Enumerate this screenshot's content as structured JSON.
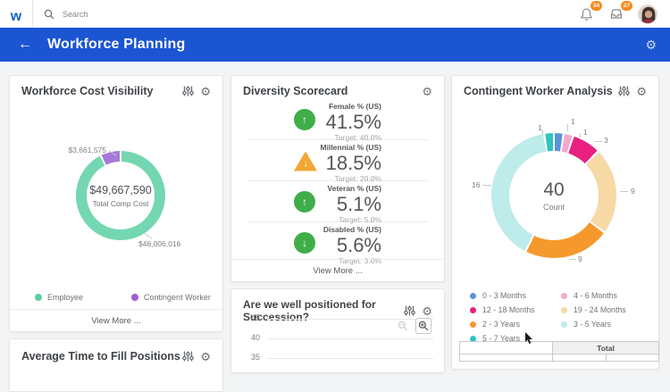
{
  "topbar": {
    "logo_letter": "w",
    "search_placeholder": "Search",
    "notifications_count": "34",
    "inbox_count": "27"
  },
  "header": {
    "back_arrow": "←",
    "title": "Workforce Planning"
  },
  "cards": {
    "workforce_cost": {
      "title": "Workforce Cost Visibility",
      "center_value": "$49,667,590",
      "center_label": "Total Comp Cost",
      "callout_contingent": "$3,661,575",
      "callout_employee": "$46,006,016",
      "legend": [
        {
          "label": "Employee",
          "color": "#5ecf9e"
        },
        {
          "label": "Contingent Worker",
          "color": "#9d5fd3"
        }
      ],
      "view_more": "View More ..."
    },
    "diversity": {
      "title": "Diversity Scorecard",
      "items": [
        {
          "label": "Female % (US)",
          "value": "41.5%",
          "target": "Target: 40.0%",
          "status": "up",
          "arrow": "↑",
          "color": "#3fae49"
        },
        {
          "label": "Millennial % (US)",
          "value": "18.5%",
          "target": "Target: 20.0%",
          "status": "warning",
          "arrow": "↓",
          "color": "#f0a734"
        },
        {
          "label": "Veteran % (US)",
          "value": "5.1%",
          "target": "Target: 5.0%",
          "status": "up",
          "arrow": "↑",
          "color": "#3fae49"
        },
        {
          "label": "Disabled % (US)",
          "value": "5.6%",
          "target": "Target: 3.0%",
          "status": "down",
          "arrow": "↓",
          "color": "#3fae49"
        }
      ],
      "view_more": "View More ..."
    },
    "contingent": {
      "title": "Contingent Worker Analysis",
      "center_value": "40",
      "center_label": "Count",
      "table_total_header": "Total"
    },
    "succession": {
      "title": "Are we well positioned for Succession?",
      "y_ticks": [
        "45",
        "40",
        "35"
      ]
    },
    "avg_time": {
      "title": "Average Time to Fill Positions"
    }
  },
  "chart_data": [
    {
      "type": "pie",
      "title": "Workforce Cost Visibility",
      "center_value": "$49,667,590",
      "center_label": "Total Comp Cost",
      "segments": [
        {
          "name": "Employee",
          "value": 46006016,
          "color": "#74d7b2",
          "label": "$46,006,016"
        },
        {
          "name": "Contingent Worker",
          "value": 3661575,
          "color": "#a878d9",
          "label": "$3,661,575"
        }
      ]
    },
    {
      "type": "pie",
      "title": "Contingent Worker Analysis",
      "center_value": 40,
      "center_label": "Count",
      "segments": [
        {
          "name": "0 - 3 Months",
          "value": 1,
          "color": "#5a94d8"
        },
        {
          "name": "4 - 6 Months",
          "value": 1,
          "color": "#f4a8cf"
        },
        {
          "name": "12 - 18 Months",
          "value": 3,
          "color": "#ea1f7f"
        },
        {
          "name": "19 - 24 Months",
          "value": 9,
          "color": "#f7d9a6"
        },
        {
          "name": "2 - 3 Years",
          "value": 9,
          "color": "#f5992d"
        },
        {
          "name": "3 - 5 Years",
          "value": 16,
          "color": "#bdecea"
        },
        {
          "name": "5 - 7 Years",
          "value": 1,
          "color": "#2fc4c0"
        }
      ]
    },
    {
      "type": "line",
      "title": "Are we well positioned for Succession?",
      "visible_y_ticks": [
        45,
        40,
        35
      ],
      "note": "chart area cropped at bottom of screenshot"
    }
  ]
}
